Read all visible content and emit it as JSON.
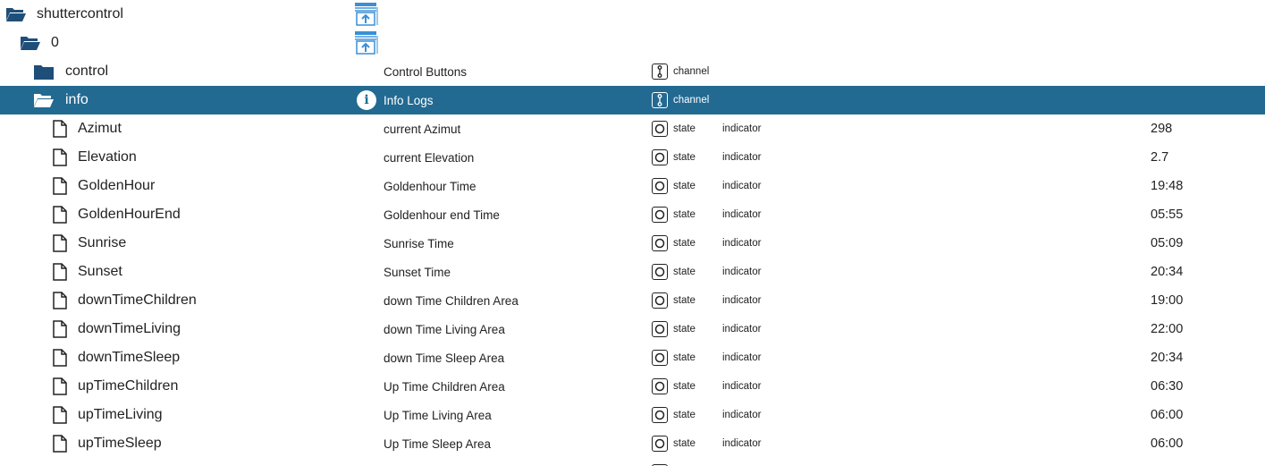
{
  "tree": {
    "adapter": {
      "name": "shuttercontrol"
    },
    "instance": {
      "name": "0"
    },
    "channels": [
      {
        "name": "control",
        "description": "Control Buttons",
        "type": "channel"
      },
      {
        "name": "info",
        "description": "Info Logs",
        "type": "channel",
        "icon": "info-icon"
      }
    ],
    "states": [
      {
        "name": "Azimut",
        "description": "current Azimut",
        "type": "state",
        "role": "indicator",
        "value": "298"
      },
      {
        "name": "Elevation",
        "description": "current Elevation",
        "type": "state",
        "role": "indicator",
        "value": "2.7"
      },
      {
        "name": "GoldenHour",
        "description": "Goldenhour Time",
        "type": "state",
        "role": "indicator",
        "value": "19:48"
      },
      {
        "name": "GoldenHourEnd",
        "description": "Goldenhour end Time",
        "type": "state",
        "role": "indicator",
        "value": "05:55"
      },
      {
        "name": "Sunrise",
        "description": "Sunrise Time",
        "type": "state",
        "role": "indicator",
        "value": "05:09"
      },
      {
        "name": "Sunset",
        "description": "Sunset Time",
        "type": "state",
        "role": "indicator",
        "value": "20:34"
      },
      {
        "name": "downTimeChildren",
        "description": "down Time Children Area",
        "type": "state",
        "role": "indicator",
        "value": "19:00"
      },
      {
        "name": "downTimeLiving",
        "description": "down Time Living Area",
        "type": "state",
        "role": "indicator",
        "value": "22:00"
      },
      {
        "name": "downTimeSleep",
        "description": "down Time Sleep Area",
        "type": "state",
        "role": "indicator",
        "value": "20:34"
      },
      {
        "name": "upTimeChildren",
        "description": "Up Time Children Area",
        "type": "state",
        "role": "indicator",
        "value": "06:30"
      },
      {
        "name": "upTimeLiving",
        "description": "Up Time Living Area",
        "type": "state",
        "role": "indicator",
        "value": "06:00"
      },
      {
        "name": "upTimeSleep",
        "description": "Up Time Sleep Area",
        "type": "state",
        "role": "indicator",
        "value": "06:00"
      }
    ],
    "selected": "info",
    "colors": {
      "selected_bg": "#226a92",
      "folder": "#1f4e79",
      "adapter_icon": "#3a8fd6"
    },
    "icons": {
      "open_folder": "folder-open-icon",
      "closed_folder": "folder-closed-icon",
      "file": "file-icon",
      "adapter": "shutter-adapter-icon",
      "channel_type": "channel-type-icon",
      "state_type": "state-type-icon"
    }
  }
}
